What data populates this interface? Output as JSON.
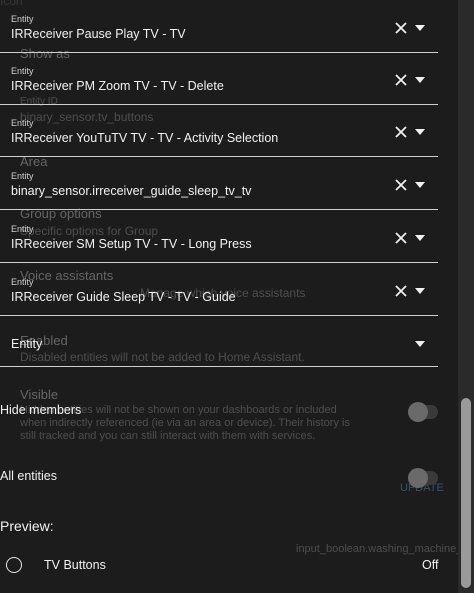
{
  "background_page": {
    "top_fragment": "Icon",
    "show_as": "Show as",
    "entity_id_label": "Entity ID",
    "entity_id_value": "binary_sensor.tv_buttons",
    "area": "Area",
    "group_options": "Group options",
    "group_options_sub": "Specific options for Group",
    "voice_assistants": "Voice assistants",
    "voice_assistants_sub": "Manage which voice assistants",
    "enabled": "Enabled",
    "enabled_sub": "Disabled entities will not be added to Home Assistant.",
    "visible": "Visible",
    "visible_sub": "Hidden entities will not be shown on your dashboards or included when indirectly referenced (ie via an area or device). Their history is still tracked and you can still interact with them with services.",
    "update": "UPDATE",
    "side_text": "input_boolean.washing_machine_a"
  },
  "entity_rows": [
    {
      "label": "Entity",
      "value": "IRReceiver Pause Play TV - TV"
    },
    {
      "label": "Entity",
      "value": "IRReceiver PM Zoom TV - TV - Delete"
    },
    {
      "label": "Entity",
      "value": "IRReceiver YouTuTV TV - TV - Activity Selection"
    },
    {
      "label": "Entity",
      "value": "binary_sensor.irreceiver_guide_sleep_tv_tv"
    },
    {
      "label": "Entity",
      "value": "IRReceiver SM Setup TV - TV - Long Press"
    },
    {
      "label": "Entity",
      "value": "IRReceiver Guide Sleep TV - TV - Guide"
    }
  ],
  "empty_entity": {
    "label": "Entity"
  },
  "options": {
    "hide_members": "Hide members",
    "all_entities": "All entities"
  },
  "preview": {
    "title": "Preview:",
    "name": "TV Buttons",
    "state": "Off"
  },
  "icons": {
    "clear": "close-icon",
    "dropdown": "caret-down-icon",
    "radio": "radio-off-icon"
  }
}
